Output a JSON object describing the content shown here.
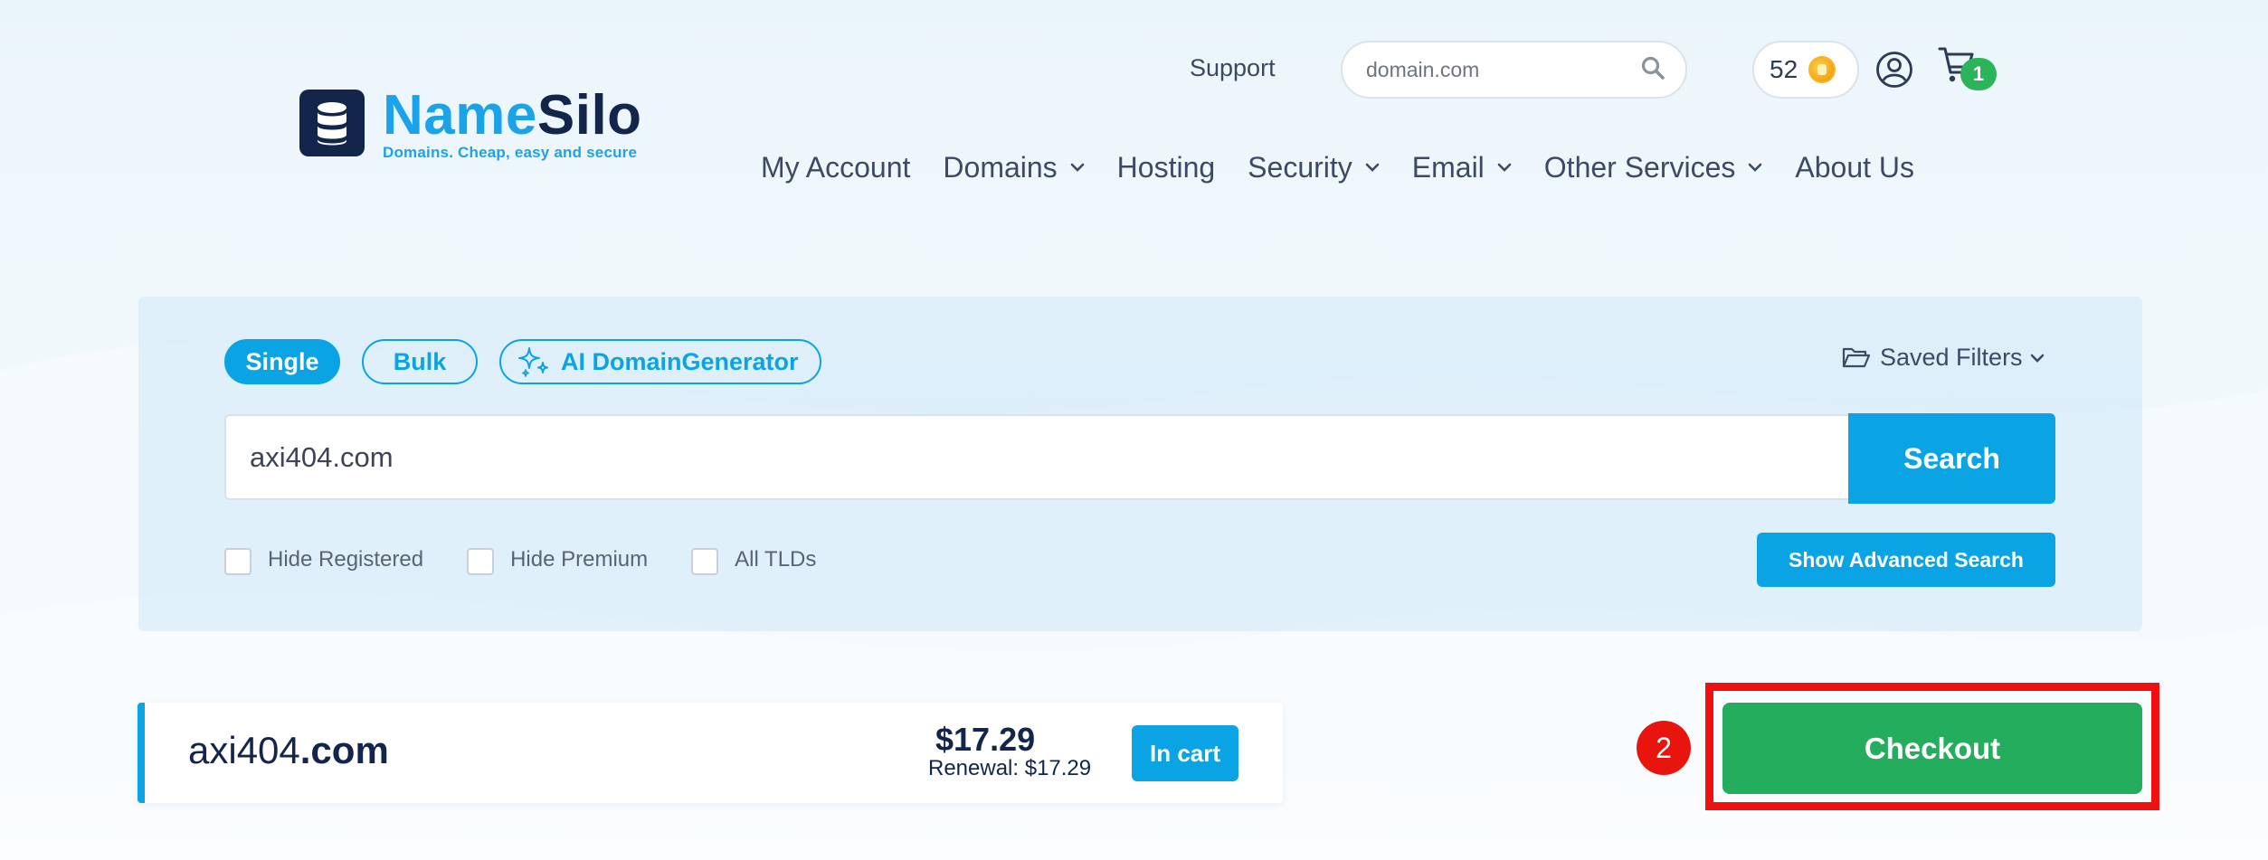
{
  "header": {
    "logo": {
      "name_part1": "Name",
      "name_part2": "Silo",
      "tagline": "Domains. Cheap, easy and secure"
    },
    "support_label": "Support",
    "search_placeholder": "domain.com",
    "coins_count": "52",
    "cart_count": "1",
    "nav": [
      {
        "label": "My Account",
        "has_dropdown": false
      },
      {
        "label": "Domains",
        "has_dropdown": true
      },
      {
        "label": "Hosting",
        "has_dropdown": false
      },
      {
        "label": "Security",
        "has_dropdown": true
      },
      {
        "label": "Email",
        "has_dropdown": true
      },
      {
        "label": "Other Services",
        "has_dropdown": true
      },
      {
        "label": "About Us",
        "has_dropdown": false
      }
    ]
  },
  "search_panel": {
    "tabs": [
      {
        "label": "Single",
        "active": true
      },
      {
        "label": "Bulk",
        "active": false
      },
      {
        "label": "AI DomainGenerator",
        "active": false,
        "icon": "sparkle-icon"
      }
    ],
    "saved_filters_label": "Saved Filters",
    "query_value": "axi404.com",
    "search_button": "Search",
    "filters": [
      {
        "label": "Hide Registered",
        "checked": false
      },
      {
        "label": "Hide Premium",
        "checked": false
      },
      {
        "label": "All TLDs",
        "checked": false
      }
    ],
    "advanced_button": "Show Advanced Search"
  },
  "result": {
    "domain_name": "axi404",
    "domain_tld": ".com",
    "price": "$17.29",
    "renewal": "Renewal: $17.29",
    "status_button": "In cart"
  },
  "checkout": {
    "step_number": "2",
    "button_label": "Checkout"
  },
  "colors": {
    "brand_blue": "#0aa4e5",
    "brand_navy": "#13254a",
    "checkout_green": "#23ad5c",
    "badge_green": "#2cb45a",
    "highlight_red": "#f01010"
  }
}
